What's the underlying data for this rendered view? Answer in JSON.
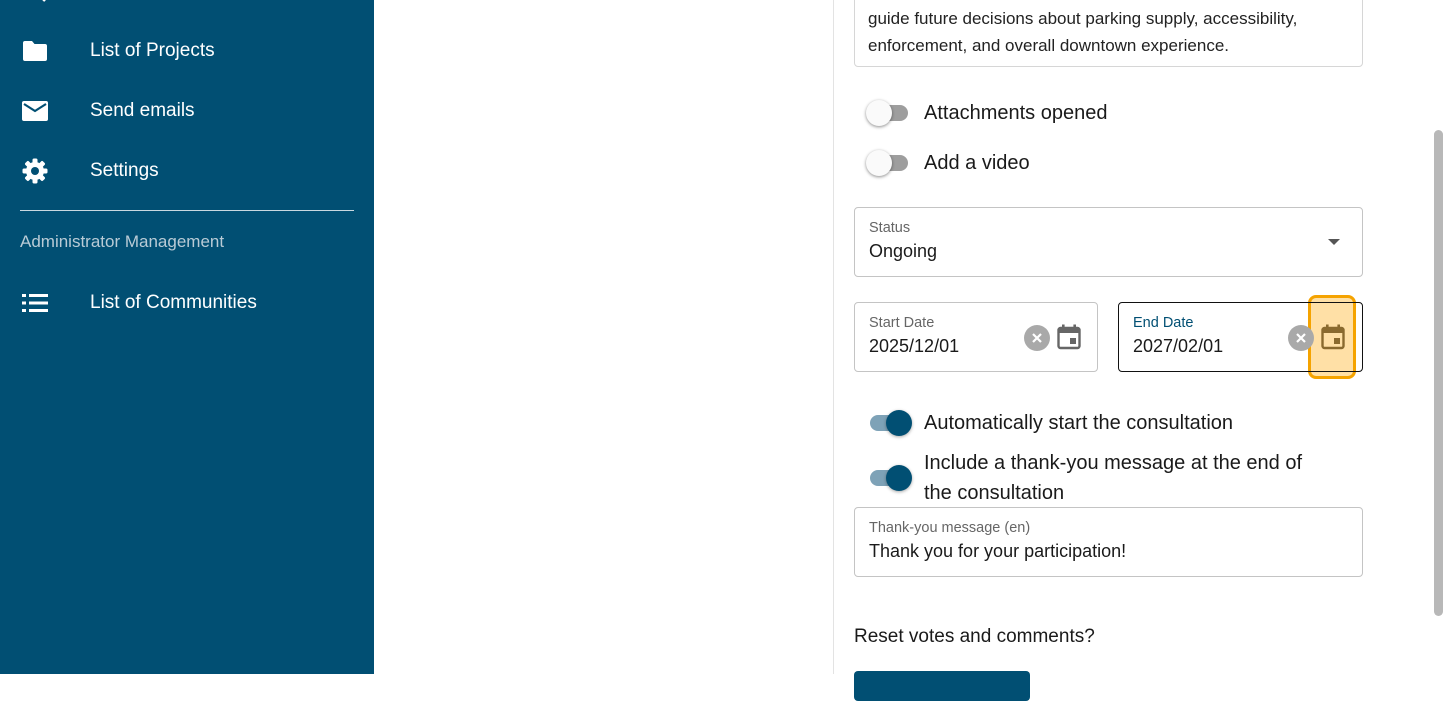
{
  "sidebar": {
    "items": [
      {
        "label": "List of Projects",
        "icon": "folder-icon"
      },
      {
        "label": "Send emails",
        "icon": "envelope-icon"
      },
      {
        "label": "Settings",
        "icon": "gear-icon"
      }
    ],
    "section_title": "Administrator Management",
    "admin_items": [
      {
        "label": "List of Communities",
        "icon": "list-icon"
      }
    ]
  },
  "form": {
    "description_text": "guide future decisions about parking supply, accessibility, enforcement, and overall downtown experience.",
    "toggles": {
      "attachments": {
        "label": "Attachments opened",
        "on": false
      },
      "video": {
        "label": "Add a video",
        "on": false
      },
      "auto_start": {
        "label": "Automatically start the consultation",
        "on": true
      },
      "thank_you": {
        "label": "Include a thank-you message at the end of the consultation",
        "on": true
      }
    },
    "status": {
      "label": "Status",
      "value": "Ongoing"
    },
    "start_date": {
      "label": "Start Date",
      "value": "2025/12/01"
    },
    "end_date": {
      "label": "End Date",
      "value": "2027/02/01"
    },
    "thank_you_message": {
      "label": "Thank-you message (en)",
      "value": "Thank you for your participation!"
    },
    "reset_label": "Reset votes and comments?"
  },
  "colors": {
    "sidebar_bg": "#014f73",
    "accent": "#014f73",
    "highlight": "#f5a300"
  }
}
